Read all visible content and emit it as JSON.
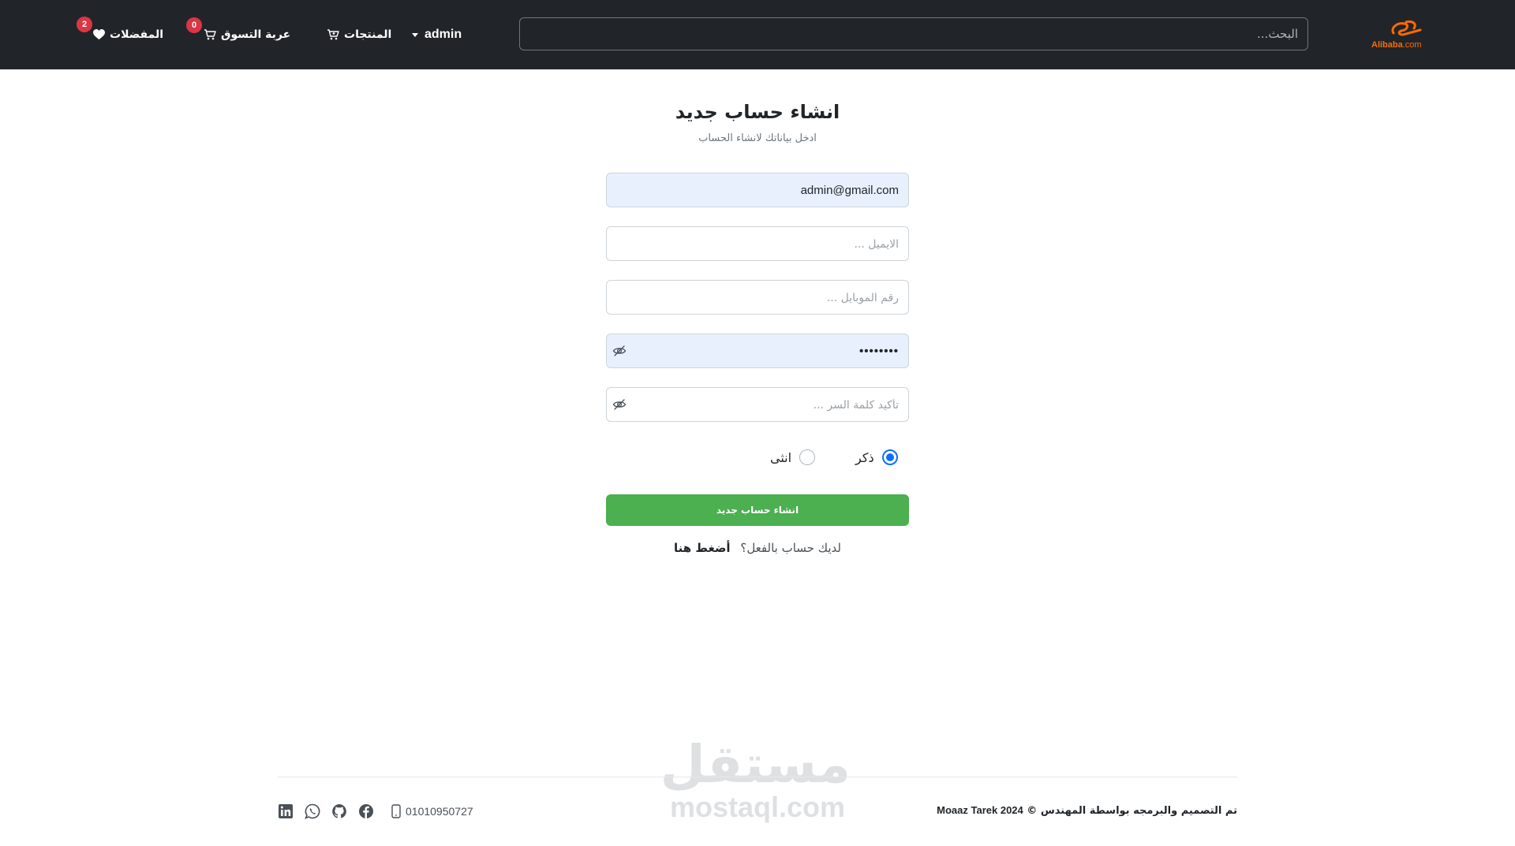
{
  "header": {
    "logo": {
      "name": "Alibaba",
      "suffix": ".com",
      "accent": "#ff6a00"
    },
    "search": {
      "placeholder": "البحث..."
    },
    "nav": {
      "user": {
        "label": "admin",
        "icon": "caret-down-icon"
      },
      "products": {
        "label": "المنتجات",
        "icon": "cart-plus-icon"
      },
      "cart": {
        "label": "عربة التسوق",
        "icon": "cart-icon",
        "count": "0"
      },
      "favorites": {
        "label": "المفضلات",
        "icon": "heart-icon",
        "count": "2"
      }
    },
    "background": "#212529"
  },
  "form": {
    "title": "انشاء حساب جديد",
    "subtitle": "ادخل بياناتك لانشاء الحساب",
    "name": {
      "value": "admin@gmail.com",
      "placeholder": ""
    },
    "email": {
      "value": "",
      "placeholder": "الايميل ..."
    },
    "mobile": {
      "value": "",
      "placeholder": "رقم الموبايل ..."
    },
    "password": {
      "value": "••••••••",
      "placeholder": "",
      "icon": "eye-slash-icon"
    },
    "confirm_password": {
      "value": "",
      "placeholder": "تأكيد كلمة السر ...",
      "icon": "eye-slash-icon"
    },
    "gender": {
      "male": {
        "label": "ذكر",
        "checked": true
      },
      "female": {
        "label": "انثى",
        "checked": false
      }
    },
    "submit_label": "انشاء حساب جديد",
    "submit_color": "#4caf50",
    "login_prompt": "لديك حساب بالفعل؟",
    "login_link": "أضغط هنا"
  },
  "footer": {
    "copyright_text": "تم التصميم والبرمجه بواسطة المهندس ©",
    "copyright_brand": "Moaaz Tarek 2024",
    "phone": "01010950727",
    "social": [
      "linkedin-icon",
      "whatsapp-icon",
      "github-icon",
      "facebook-icon",
      "mobile-phone-icon"
    ]
  },
  "watermark": {
    "arabic": "مستقل",
    "latin": "mostaql.com"
  }
}
